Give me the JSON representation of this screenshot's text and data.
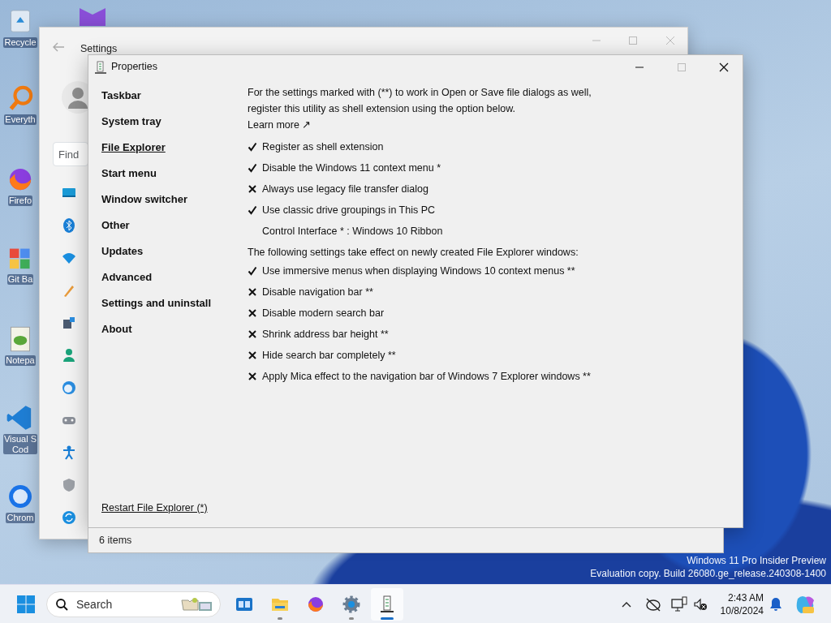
{
  "desktop": {
    "icons": [
      {
        "kind": "recycle",
        "label": "Recycle"
      },
      {
        "kind": "search-app",
        "label": "Everyth"
      },
      {
        "kind": "browser-fox",
        "label": "Firefo"
      },
      {
        "kind": "git",
        "label": "Git Ba"
      },
      {
        "kind": "notepad",
        "label": "Notepa"
      },
      {
        "kind": "code",
        "label": "Visual S\nCod"
      },
      {
        "kind": "browser-ring",
        "label": "Chrom"
      }
    ],
    "os_notice": [
      "Windows 11 Pro Insider Preview",
      "Evaluation copy. Build 26080.ge_release.240308-1400"
    ]
  },
  "settings_window": {
    "title": "Settings",
    "search": {
      "placeholder": "Find"
    }
  },
  "properties_window": {
    "title": "Properties",
    "nav": [
      {
        "label": "Taskbar",
        "selected": false
      },
      {
        "label": "System tray",
        "selected": false
      },
      {
        "label": "File Explorer",
        "selected": true
      },
      {
        "label": "Start menu",
        "selected": false
      },
      {
        "label": "Window switcher",
        "selected": false
      },
      {
        "label": "Other",
        "selected": false
      },
      {
        "label": "Updates",
        "selected": false
      },
      {
        "label": "Advanced",
        "selected": false
      },
      {
        "label": "Settings and uninstall",
        "selected": false
      },
      {
        "label": "About",
        "selected": false
      }
    ],
    "content": [
      {
        "kind": "note",
        "text": "For the settings marked with (**) to work in Open or Save file dialogs as well, register this utility as shell extension using the option below."
      },
      {
        "kind": "link",
        "text": "Learn more ↗"
      },
      {
        "kind": "toggle",
        "text": "Register as shell extension",
        "checked": true
      },
      {
        "kind": "toggle",
        "text": "Disable the Windows 11 context menu *",
        "checked": true
      },
      {
        "kind": "toggle",
        "text": "Always use legacy file transfer dialog",
        "checked": false
      },
      {
        "kind": "toggle",
        "text": "Use classic drive groupings in This PC",
        "checked": true
      },
      {
        "kind": "choice",
        "text": "Control Interface * : Windows 10 Ribbon"
      },
      {
        "kind": "note",
        "text": "The following settings take effect on newly created File Explorer windows:"
      },
      {
        "kind": "toggle",
        "text": "Use immersive menus when displaying Windows 10 context menus **",
        "checked": true
      },
      {
        "kind": "toggle",
        "text": "Disable navigation bar **",
        "checked": false
      },
      {
        "kind": "toggle",
        "text": "Disable modern search bar",
        "checked": false
      },
      {
        "kind": "toggle",
        "text": "Shrink address bar height **",
        "checked": false
      },
      {
        "kind": "toggle",
        "text": "Hide search bar completely **",
        "checked": false
      },
      {
        "kind": "toggle",
        "text": "Apply Mica effect to the navigation bar of Windows 7 Explorer windows **",
        "checked": false
      }
    ],
    "restart_link": "Restart File Explorer (*)",
    "status_bar": "6 items"
  },
  "taskbar": {
    "search": {
      "placeholder": "Search"
    },
    "apps": [
      {
        "kind": "widgets",
        "running": false,
        "active": false
      },
      {
        "kind": "folder",
        "running": true,
        "active": false
      },
      {
        "kind": "browser-fox",
        "running": false,
        "active": false
      },
      {
        "kind": "gear",
        "running": true,
        "active": false
      },
      {
        "kind": "tool",
        "running": true,
        "active": true
      }
    ],
    "clock": {
      "time": "2:43 AM",
      "date": "10/8/2024"
    }
  }
}
